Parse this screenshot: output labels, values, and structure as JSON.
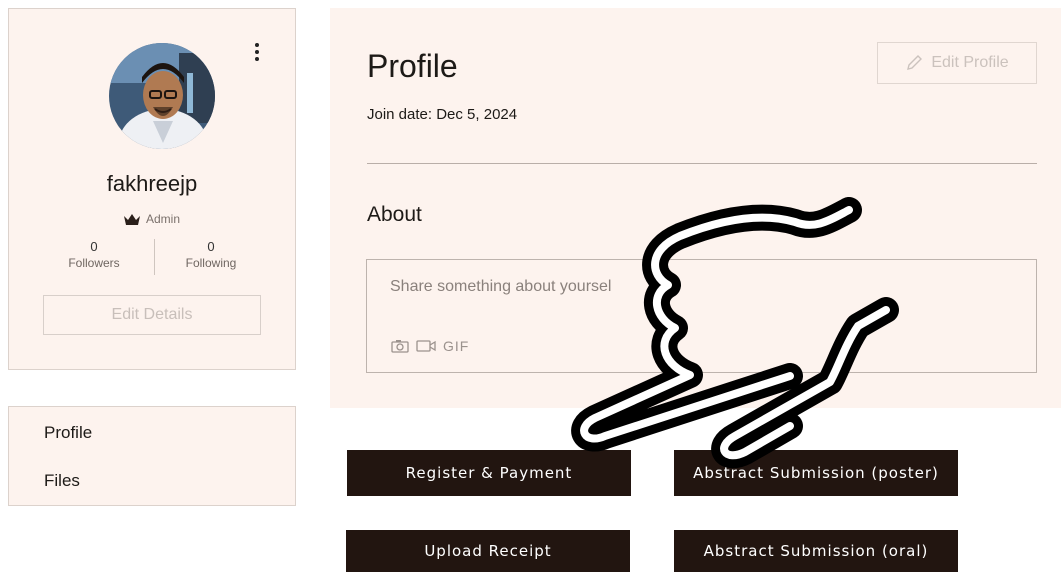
{
  "profile_card": {
    "username": "fakhreejp",
    "role": "Admin",
    "followers": {
      "count": "0",
      "label": "Followers"
    },
    "following": {
      "count": "0",
      "label": "Following"
    },
    "edit_details_label": "Edit Details"
  },
  "side_menu": {
    "items": [
      {
        "label": "Profile"
      },
      {
        "label": "Files"
      }
    ]
  },
  "main": {
    "title": "Profile",
    "join_date": "Join date: Dec 5, 2024",
    "edit_profile_label": "Edit Profile",
    "about_heading": "About",
    "about_placeholder": "Share something about yoursel",
    "gif_label": "GIF"
  },
  "actions": {
    "register_payment": "Register & Payment",
    "abstract_poster": "Abstract Submission (poster)",
    "upload_receipt": "Upload Receipt",
    "abstract_oral": "Abstract Submission (oral)"
  },
  "colors": {
    "card_bg": "#fdf3ee",
    "button_bg": "#221510",
    "button_text": "#ffffff"
  },
  "icons": [
    "more-vertical-icon",
    "crown-icon",
    "pencil-icon",
    "camera-icon",
    "video-icon",
    "pointing-hand-icon"
  ]
}
